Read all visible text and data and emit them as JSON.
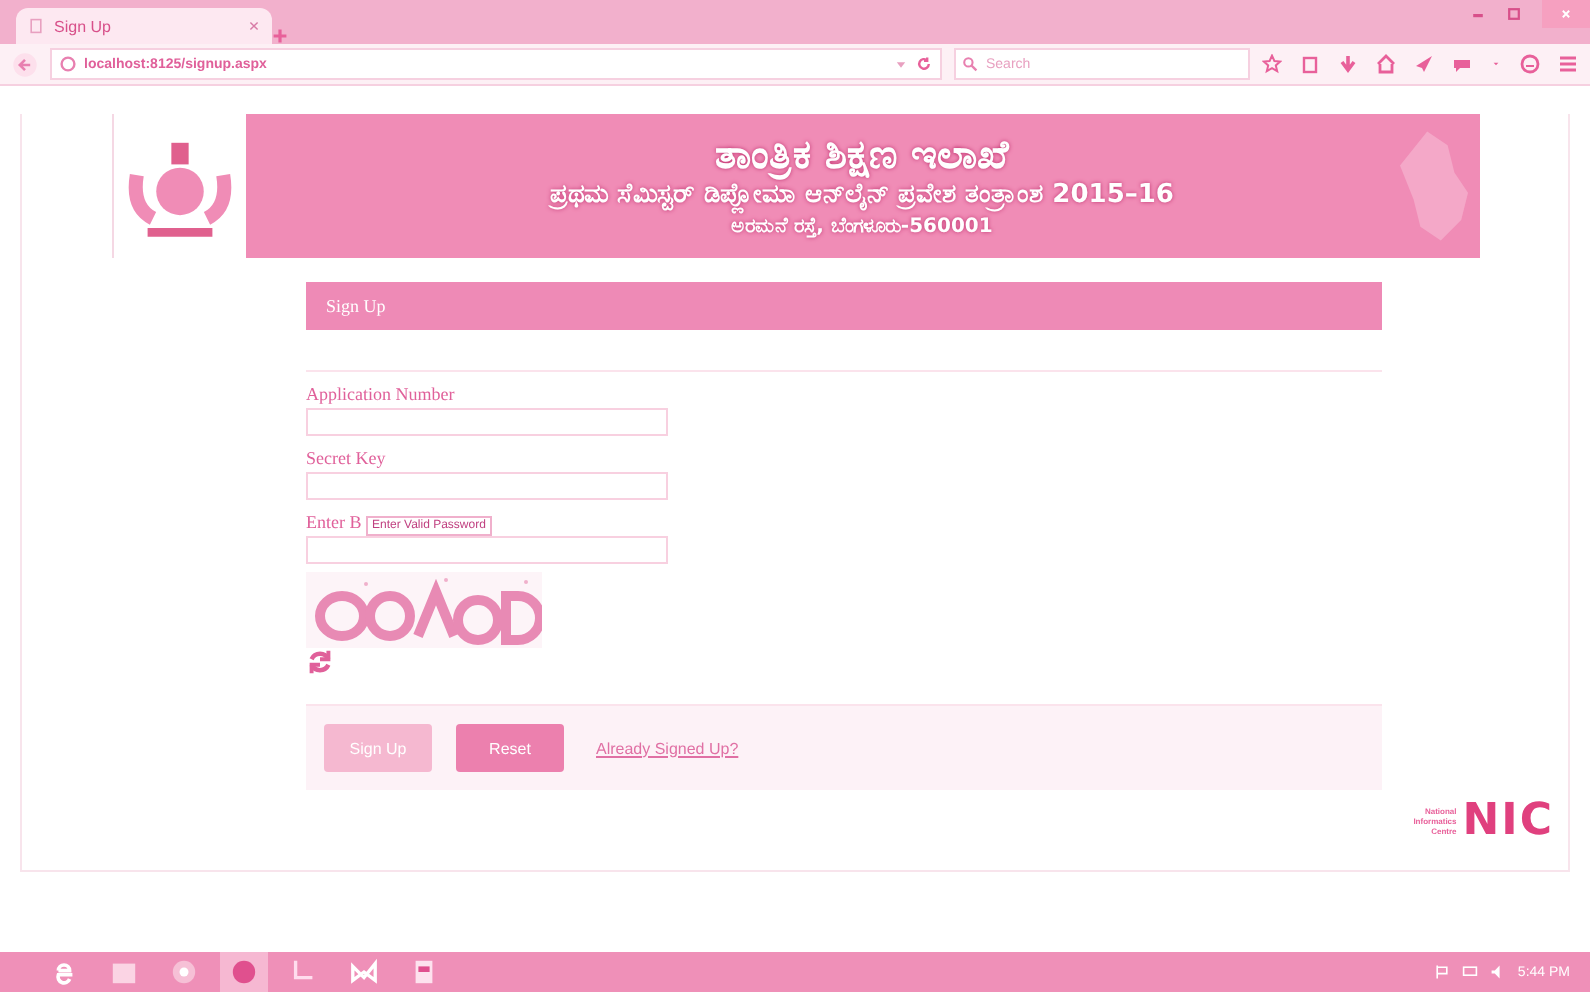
{
  "browser": {
    "tabs": [
      {
        "title": "Sign Up",
        "selected": true
      }
    ],
    "address": "localhost:8125/signup.aspx",
    "search": {
      "placeholder": "Search"
    }
  },
  "banner": {
    "title": "ತಾಂತ್ರಿಕ ಶಿಕ್ಷಣ ಇಲಾಖೆ",
    "subtitle": "ಪ್ರಥಮ ಸೆಮಿಸ್ಟರ್ ಡಿಪ್ಲೋಮಾ ಆನ್‌ಲೈನ್ ಪ್ರವೇಶ ತಂತ್ರಾಂಶ 2015–16",
    "address": "ಅರಮನೆ ರಸ್ತೆ, ಬೆಂಗಳೂರು-560001"
  },
  "form": {
    "title": "Sign Up",
    "fields": [
      {
        "label": "Application Number"
      },
      {
        "label": "Secret Key"
      },
      {
        "label": "Enter B",
        "tooltip": "Enter Valid Password"
      }
    ],
    "buttons": [
      {
        "label": "Sign Up",
        "disabled": true
      },
      {
        "label": "Reset",
        "disabled": false
      }
    ],
    "link": "Already Signed Up?"
  },
  "footer_logo": {
    "lines": [
      "National",
      "Informatics",
      "Centre"
    ],
    "mark": "NIC"
  },
  "taskbar": {
    "apps": [
      {
        "kind": "browser",
        "selected": false
      },
      {
        "kind": "folder",
        "selected": false
      },
      {
        "kind": "chrome",
        "selected": false
      },
      {
        "kind": "firefox",
        "selected": true
      },
      {
        "kind": "tool",
        "selected": false
      },
      {
        "kind": "studio",
        "selected": false
      },
      {
        "kind": "slides",
        "selected": false
      }
    ],
    "time": "5:44 PM"
  }
}
